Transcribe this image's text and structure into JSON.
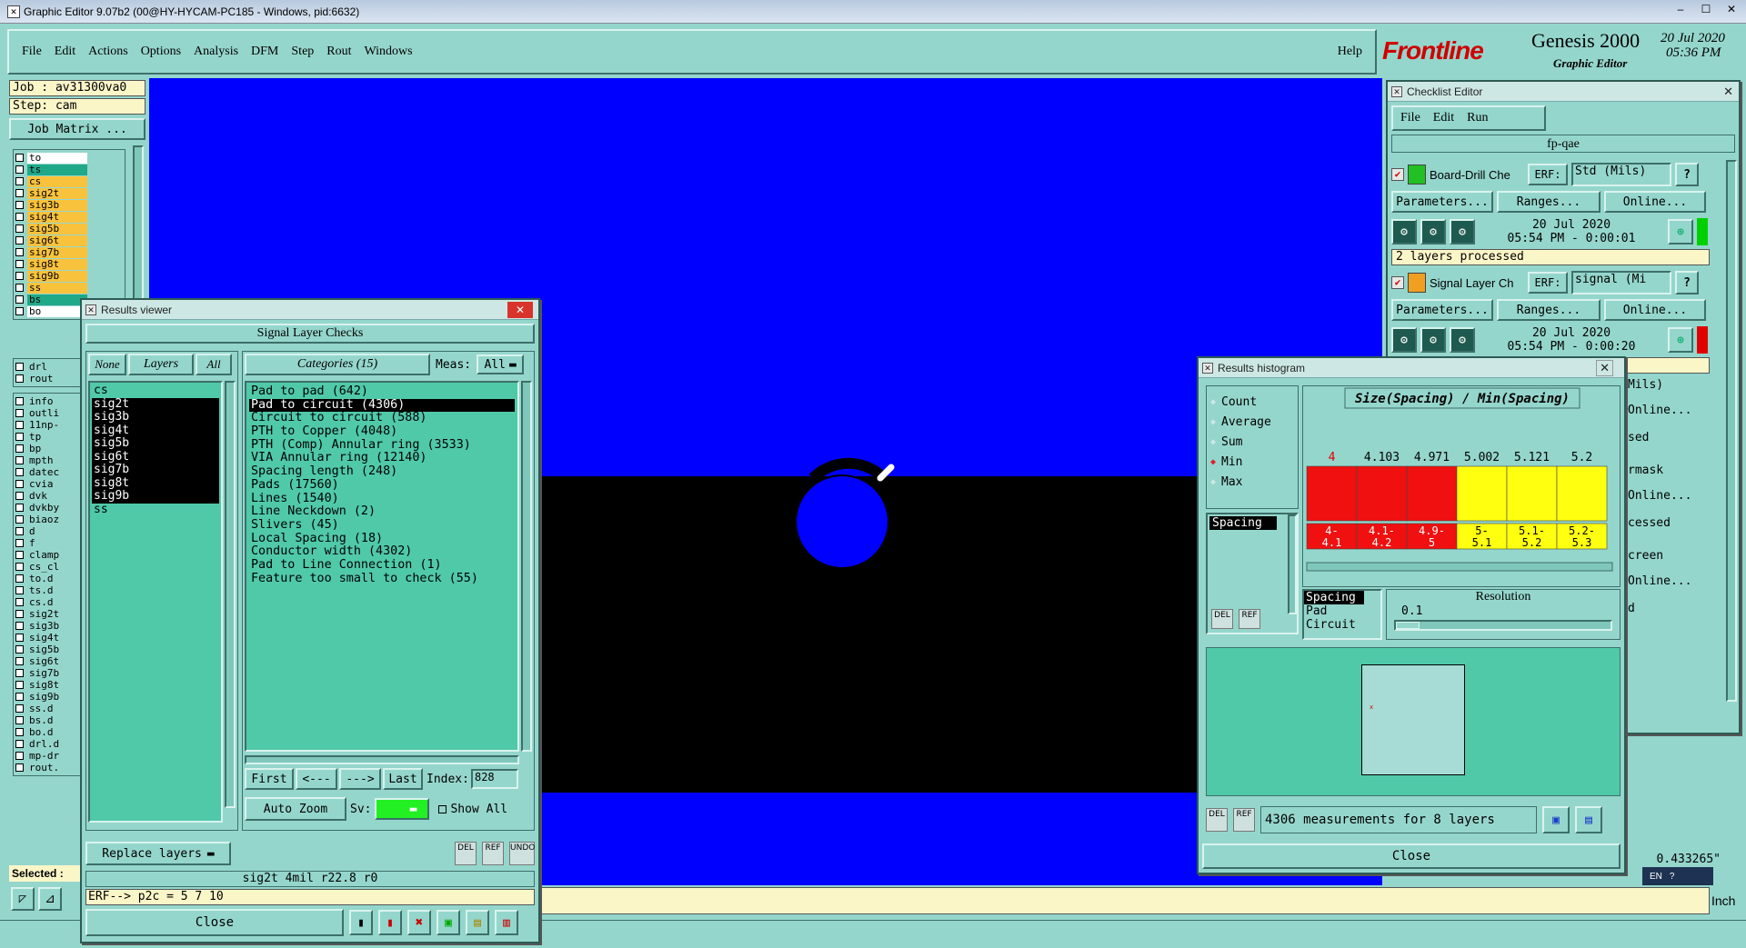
{
  "os_title": "Graphic Editor 9.07b2 (00@HY-HYCAM-PC185 - Windows, pid:6632)",
  "menu": [
    "File",
    "Edit",
    "Actions",
    "Options",
    "Analysis",
    "DFM",
    "Step",
    "Rout",
    "Windows"
  ],
  "help": "Help",
  "brand": {
    "logo": "Frontline",
    "product": "Genesis 2000",
    "subtitle": "Graphic Editor",
    "date": "20 Jul 2020",
    "time": "05:36 PM"
  },
  "job": {
    "job_label": "Job : av31300va0",
    "step_label": "Step: cam",
    "matrix_btn": "Job Matrix ..."
  },
  "layers_top": [
    {
      "name": "to",
      "color": "#ffffff"
    },
    {
      "name": "ts",
      "color": "#1fa989"
    },
    {
      "name": "cs",
      "color": "#f9c23c"
    },
    {
      "name": "sig2t",
      "color": "#f9c23c"
    },
    {
      "name": "sig3b",
      "color": "#f9c23c"
    },
    {
      "name": "sig4t",
      "color": "#f9c23c"
    },
    {
      "name": "sig5b",
      "color": "#f9c23c"
    },
    {
      "name": "sig6t",
      "color": "#f9c23c"
    },
    {
      "name": "sig7b",
      "color": "#f9c23c"
    },
    {
      "name": "sig8t",
      "color": "#f9c23c"
    },
    {
      "name": "sig9b",
      "color": "#f9c23c"
    },
    {
      "name": "ss",
      "color": "#f9c23c"
    },
    {
      "name": "bs",
      "color": "#1fa989"
    },
    {
      "name": "bo",
      "color": "#ffffff"
    }
  ],
  "layers_drill": [
    {
      "name": "drl",
      "color": "#95d6cc"
    },
    {
      "name": "rout",
      "color": "#95d6cc"
    }
  ],
  "layers_misc": [
    "info",
    "outli",
    "11np-",
    "tp",
    "bp",
    "mpth",
    "datec",
    "cvia",
    "dvk",
    "dvkby",
    "biaoz",
    "d",
    "f",
    "clamp",
    "cs_cl",
    "to.d",
    "ts.d",
    "cs.d",
    "sig2t",
    "sig3b",
    "sig4t",
    "sig5b",
    "sig6t",
    "sig7b",
    "sig8t",
    "sig9b",
    "ss.d",
    "bs.d",
    "bo.d",
    "drl.d",
    "mp-dr",
    "rout."
  ],
  "selected_label": "Selected :",
  "results_viewer": {
    "title": "Results viewer",
    "heading": "Signal Layer Checks",
    "none_btn": "None",
    "layers_btn": "Layers",
    "all_btn": "All",
    "categories_btn": "Categories (15)",
    "meas_label": "Meas:",
    "meas_value": "All",
    "layers": [
      "cs",
      "sig2t",
      "sig3b",
      "sig4t",
      "sig5b",
      "sig6t",
      "sig7b",
      "sig8t",
      "sig9b",
      "ss"
    ],
    "categories": [
      "Pad to pad (642)",
      "Pad to circuit (4306)",
      "Circuit to circuit (588)",
      "PTH to Copper (4048)",
      "PTH (Comp) Annular ring (3533)",
      "VIA Annular ring (12140)",
      "Spacing length (248)",
      "Pads (17560)",
      "Lines (1540)",
      "Line Neckdown (2)",
      "Slivers (45)",
      "Local Spacing (18)",
      "Conductor width (4302)",
      "Pad to Line Connection (1)",
      "Feature too small to check (55)"
    ],
    "nav": {
      "first": "First",
      "prev": "<---",
      "next": "--->",
      "last": "Last",
      "index_label": "Index:",
      "index_value": "828"
    },
    "auto_zoom": "Auto Zoom",
    "sv_label": "Sv:",
    "show_all": "Show All",
    "replace_layers": "Replace layers",
    "del": "DEL",
    "ref": "REF",
    "undo": "UNDO",
    "info_line": "sig2t 4mil  r22.8  r0",
    "erf_line": "ERF--> p2c = 5 7 10",
    "close": "Close"
  },
  "checklist": {
    "title": "Checklist Editor",
    "menu": [
      "File",
      "Edit",
      "Run"
    ],
    "name": "fp-qae",
    "items": [
      {
        "name": "Board-Drill Che",
        "erf": "ERF:",
        "erf_value": "Std (Mils)",
        "params": "Parameters...",
        "ranges": "Ranges...",
        "online": "Online...",
        "date": "20 Jul 2020",
        "time": "05:54 PM - 0:00:01",
        "status": "2 layers processed",
        "flag": "#00d000"
      },
      {
        "name": "Signal Layer Ch",
        "erf": "ERF:",
        "erf_value": "signal (Mi",
        "params": "Parameters...",
        "ranges": "Ranges...",
        "online": "Online...",
        "date": "20 Jul 2020",
        "time": "05:54 PM - 0:00:20",
        "status": "",
        "flag": "#e00000"
      }
    ],
    "partial": [
      "Mils)",
      "Online...",
      "sed",
      "rmask",
      "Online...",
      "cessed",
      "creen",
      "Online...",
      "d"
    ]
  },
  "histogram": {
    "title": "Results histogram",
    "modes": [
      "Count",
      "Average",
      "Sum",
      "Min",
      "Max"
    ],
    "selected_mode": "Min",
    "list_item": "Spacing",
    "chart_title": "Size(Spacing) / Min(Spacing)",
    "types": [
      "Spacing",
      "Pad",
      "Circuit"
    ],
    "resolution_label": "Resolution",
    "resolution_value": "0.1",
    "summary": "4306 measurements for 8 layers",
    "close": "Close",
    "del": "DEL",
    "ref": "REF"
  },
  "chart_data": {
    "type": "bar",
    "title": "Size(Spacing) / Min(Spacing)",
    "categories": [
      "4-4.1",
      "4.1-4.2",
      "4.9-5",
      "5-5.1",
      "5.1-5.2",
      "5.2-5.3"
    ],
    "values": [
      4,
      4.103,
      4.971,
      5.002,
      5.121,
      5.2
    ],
    "value_labels": [
      "4",
      "4.103",
      "4.971",
      "5.002",
      "5.121",
      "5.2"
    ],
    "colors": [
      "#f01010",
      "#f01010",
      "#f01010",
      "#ffff10",
      "#ffff10",
      "#ffff10"
    ]
  },
  "status": {
    "coord": "0.433265\"",
    "unit": "Inch",
    "lang": "EN"
  }
}
